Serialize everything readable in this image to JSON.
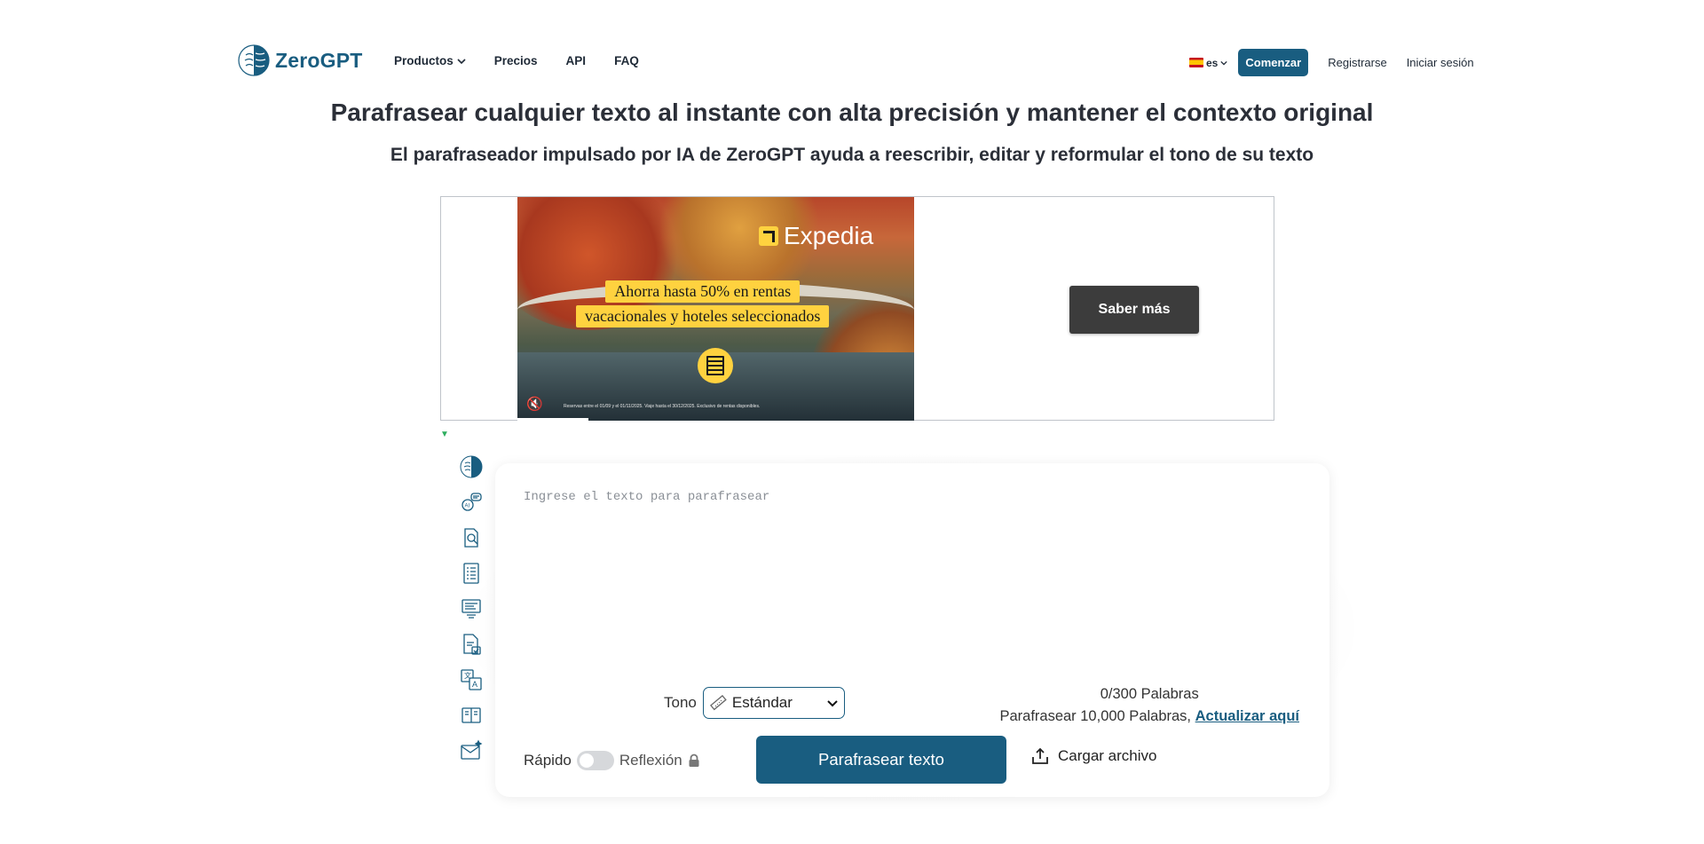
{
  "header": {
    "logo_text": "ZeroGPT",
    "nav": [
      {
        "label": "Productos",
        "has_dropdown": true
      },
      {
        "label": "Precios"
      },
      {
        "label": "API"
      },
      {
        "label": "FAQ"
      }
    ],
    "language": "es",
    "start_button": "Comenzar",
    "register": "Registrarse",
    "login": "Iniciar sesión"
  },
  "hero": {
    "title": "Parafrasear cualquier texto al instante con alta precisión y mantener el contexto original",
    "subtitle": "El parafraseador impulsado por IA de ZeroGPT ayuda a reescribir, editar y reformular el tono de su texto"
  },
  "ad": {
    "brand": "Expedia",
    "promo_line1": "Ahorra hasta 50% en rentas",
    "promo_line2": "vacacionales y hoteles seleccionados",
    "fine_print": "Reservas entre el 01/09 y el 01/11/2025. Viaje hasta el 30/12/2025. Exclusivo de rentas disponibles.",
    "cta": "Saber más",
    "colors": {
      "cta_bg": "#3c3c3c",
      "promo_bg": "#ffd23f"
    }
  },
  "sidebar": {
    "icons": [
      "brain-icon",
      "ai-chat-icon",
      "document-search-icon",
      "checklist-icon",
      "summarizer-icon",
      "document-check-icon",
      "translate-icon",
      "book-icon",
      "email-icon"
    ]
  },
  "tool": {
    "placeholder": "Ingrese el texto para parafrasear",
    "tone_label": "Tono",
    "tone_value": "Estándar",
    "word_count": "0/300 Palabras",
    "upgrade_text": "Parafrasear 10,000 Palabras,",
    "upgrade_link": "Actualizar aquí",
    "mode_fast": "Rápido",
    "mode_reflection": "Reflexión",
    "submit": "Parafrasear texto",
    "upload": "Cargar archivo",
    "colors": {
      "accent": "#195d80"
    }
  }
}
